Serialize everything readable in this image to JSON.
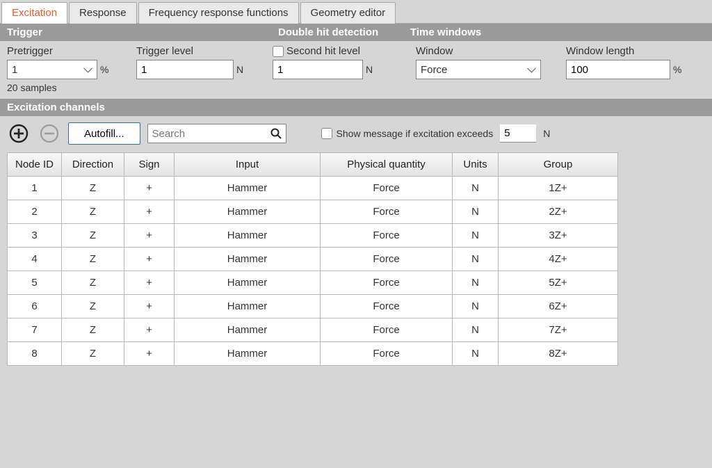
{
  "tabs": [
    {
      "label": "Excitation",
      "active": true
    },
    {
      "label": "Response",
      "active": false
    },
    {
      "label": "Frequency response functions",
      "active": false
    },
    {
      "label": "Geometry editor",
      "active": false
    }
  ],
  "sections": {
    "trigger_label": "Trigger",
    "double_hit_label": "Double hit detection",
    "time_windows_label": "Time windows",
    "excitation_channels_label": "Excitation channels"
  },
  "trigger": {
    "pretrigger_label": "Pretrigger",
    "pretrigger_value": "1",
    "pretrigger_unit": "%",
    "pretrigger_note": "20 samples",
    "level_label": "Trigger level",
    "level_value": "1",
    "level_unit": "N"
  },
  "double_hit": {
    "second_hit_label": "Second hit level",
    "second_hit_checked": false,
    "second_hit_value": "1",
    "second_hit_unit": "N"
  },
  "time_windows": {
    "window_label": "Window",
    "window_value": "Force",
    "length_label": "Window length",
    "length_value": "100",
    "length_unit": "%"
  },
  "toolbar": {
    "autofill_label": "Autofill...",
    "search_placeholder": "Search",
    "show_msg_label": "Show message if excitation exceeds",
    "exceeds_value": "5",
    "exceeds_unit": "N"
  },
  "table": {
    "headers": {
      "node_id": "Node ID",
      "direction": "Direction",
      "sign": "Sign",
      "input": "Input",
      "physical_quantity": "Physical quantity",
      "units": "Units",
      "group": "Group"
    },
    "rows": [
      {
        "node_id": "1",
        "direction": "Z",
        "sign": "+",
        "input": "Hammer",
        "pq": "Force",
        "units": "N",
        "group": "1Z+"
      },
      {
        "node_id": "2",
        "direction": "Z",
        "sign": "+",
        "input": "Hammer",
        "pq": "Force",
        "units": "N",
        "group": "2Z+"
      },
      {
        "node_id": "3",
        "direction": "Z",
        "sign": "+",
        "input": "Hammer",
        "pq": "Force",
        "units": "N",
        "group": "3Z+"
      },
      {
        "node_id": "4",
        "direction": "Z",
        "sign": "+",
        "input": "Hammer",
        "pq": "Force",
        "units": "N",
        "group": "4Z+"
      },
      {
        "node_id": "5",
        "direction": "Z",
        "sign": "+",
        "input": "Hammer",
        "pq": "Force",
        "units": "N",
        "group": "5Z+"
      },
      {
        "node_id": "6",
        "direction": "Z",
        "sign": "+",
        "input": "Hammer",
        "pq": "Force",
        "units": "N",
        "group": "6Z+"
      },
      {
        "node_id": "7",
        "direction": "Z",
        "sign": "+",
        "input": "Hammer",
        "pq": "Force",
        "units": "N",
        "group": "7Z+"
      },
      {
        "node_id": "8",
        "direction": "Z",
        "sign": "+",
        "input": "Hammer",
        "pq": "Force",
        "units": "N",
        "group": "8Z+"
      }
    ]
  }
}
